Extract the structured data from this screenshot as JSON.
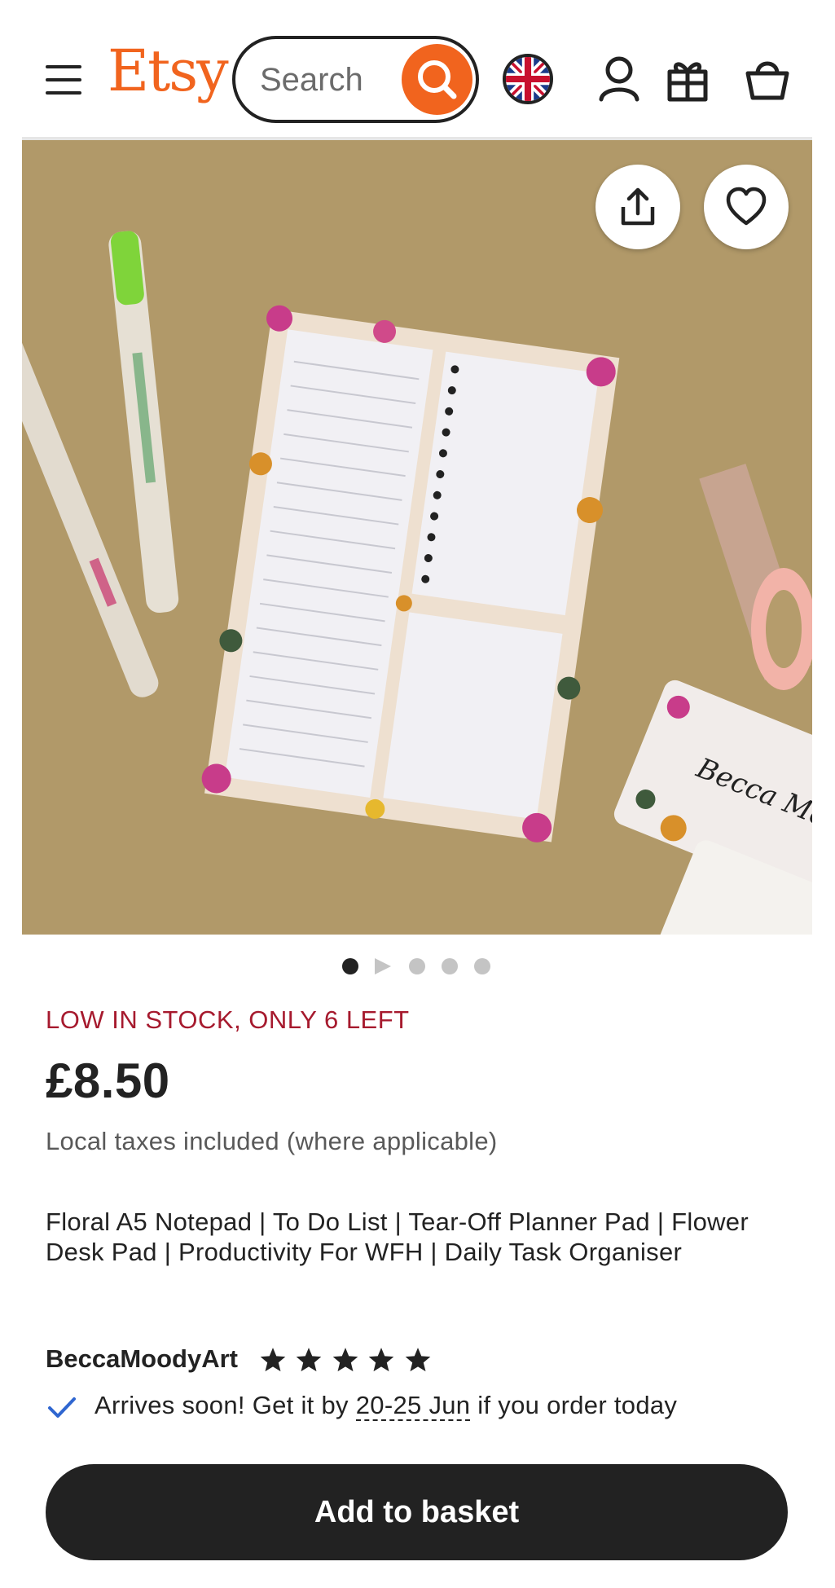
{
  "header": {
    "logo": "Etsy",
    "search_placeholder": "Search",
    "menu_icon": "hamburger-menu-icon",
    "search_icon": "search-icon",
    "flag_icon": "uk-flag-icon",
    "account_icon": "user-icon",
    "gift_icon": "gift-icon",
    "basket_icon": "shopping-bag-icon"
  },
  "gallery": {
    "share_icon": "share-icon",
    "favorite_icon": "heart-icon",
    "business_card_text": "Becca Moody Art",
    "current_slide": 1,
    "total_slides": 5
  },
  "product": {
    "stock_notice": "LOW IN STOCK, ONLY 6 LEFT",
    "price": "£8.50",
    "tax_note": "Local taxes included (where applicable)",
    "title": "Floral A5 Notepad | To Do List | Tear-Off Planner Pad | Flower Desk Pad | Productivity For WFH | Daily Task Organiser",
    "shop_name": "BeccaMoodyArt",
    "rating_stars": 5,
    "delivery_prefix": "Arrives soon! Get it by ",
    "delivery_date": "20-25 Jun",
    "delivery_suffix": " if you order today",
    "add_to_basket": "Add to basket"
  },
  "colors": {
    "brand": "#f1641e",
    "stock_alert": "#a61a2e",
    "check": "#2f66d0",
    "button_bg": "#222222"
  }
}
